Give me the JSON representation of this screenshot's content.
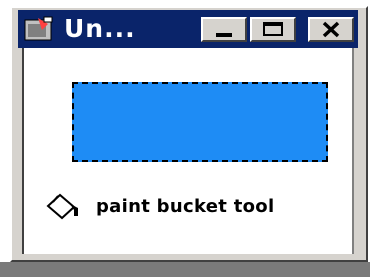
{
  "window": {
    "title": "Un...",
    "controls": {
      "minimize": "minimize",
      "maximize": "maximize",
      "close": "close"
    }
  },
  "canvas": {
    "selection_fill": "#1e8cf5",
    "tool_icon": "paint-bucket-icon",
    "tool_label": "paint bucket tool"
  },
  "colors": {
    "titlebar": "#0a246a",
    "chrome": "#d6d3ce"
  }
}
